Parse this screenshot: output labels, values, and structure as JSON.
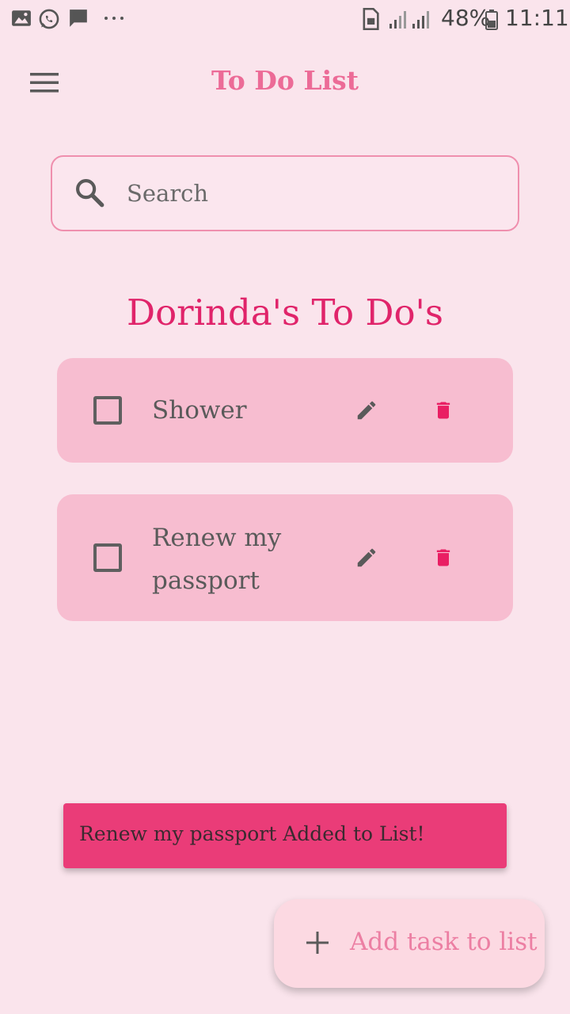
{
  "status_bar": {
    "battery": "48%",
    "time": "11:11",
    "icons": [
      "gallery-icon",
      "whatsapp-icon",
      "message-icon",
      "more-dots-icon",
      "sim-icon",
      "signal-icon",
      "battery-icon"
    ]
  },
  "app_bar": {
    "title": "To Do List",
    "menu_icon": "menu-icon"
  },
  "search": {
    "placeholder": "Search",
    "value": ""
  },
  "list": {
    "heading": "Dorinda's To Do's",
    "tasks": [
      {
        "label": "Shower",
        "checked": false
      },
      {
        "label": "Renew my passport",
        "checked": false
      }
    ]
  },
  "snackbar": {
    "message": "Renew my passport Added to List!"
  },
  "fab": {
    "label": "Add task to list",
    "icon": "plus-icon"
  },
  "colors": {
    "background": "#fae4ec",
    "accent": "#e0246a",
    "title": "#ec6b97",
    "card": "#f7bdd0",
    "snackbar": "#ea3c78",
    "delete": "#e91e63"
  }
}
